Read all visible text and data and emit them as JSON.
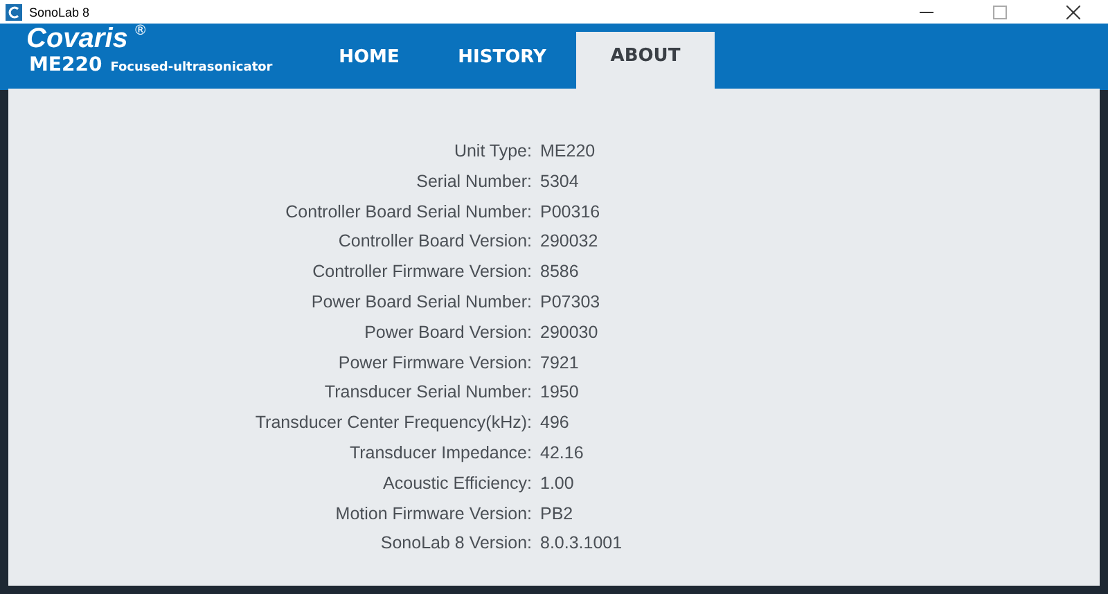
{
  "window": {
    "title": "SonoLab 8"
  },
  "header": {
    "brand": "Covaris",
    "brand_mark": "®",
    "model": "ME220",
    "product": "Focused-ultrasonicator"
  },
  "tabs": [
    {
      "label": "HOME",
      "selected": false
    },
    {
      "label": "HISTORY",
      "selected": false
    },
    {
      "label": "ABOUT",
      "selected": true
    }
  ],
  "about": [
    {
      "label": "Unit Type:",
      "value": "ME220"
    },
    {
      "label": "Serial Number:",
      "value": "5304"
    },
    {
      "label": "Controller Board Serial Number:",
      "value": "P00316"
    },
    {
      "label": "Controller Board Version:",
      "value": "290032"
    },
    {
      "label": "Controller Firmware Version:",
      "value": "8586"
    },
    {
      "label": "Power Board Serial Number:",
      "value": "P07303"
    },
    {
      "label": "Power Board Version:",
      "value": "290030"
    },
    {
      "label": "Power Firmware Version:",
      "value": "7921"
    },
    {
      "label": "Transducer Serial Number:",
      "value": "1950"
    },
    {
      "label": "Transducer Center Frequency(kHz):",
      "value": "496"
    },
    {
      "label": "Transducer Impedance:",
      "value": "42.16"
    },
    {
      "label": "Acoustic Efficiency:",
      "value": "1.00"
    },
    {
      "label": "Motion Firmware Version:",
      "value": "PB2"
    },
    {
      "label": "SonoLab 8 Version:",
      "value": "8.0.3.1001"
    }
  ]
}
